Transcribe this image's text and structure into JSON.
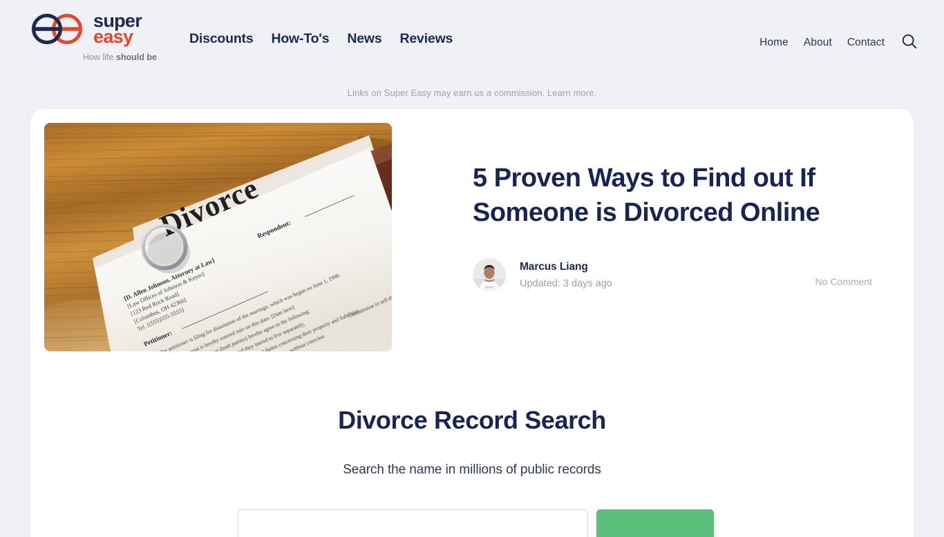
{
  "brand": {
    "name_part1": "super",
    "name_part2": "easy",
    "tagline_prefix": "How life ",
    "tagline_strong": "should be",
    "logo_navy": "#1b2a4e",
    "logo_red": "#e8452c"
  },
  "nav": {
    "primary": [
      {
        "label": "Discounts"
      },
      {
        "label": "How-To's"
      },
      {
        "label": "News"
      },
      {
        "label": "Reviews"
      }
    ],
    "utility": [
      {
        "label": "Home"
      },
      {
        "label": "About"
      },
      {
        "label": "Contact"
      }
    ],
    "search_icon": "search-icon"
  },
  "disclaimer": {
    "text": "Links on Super Easy may earn us a commission. ",
    "link_label": "Learn more."
  },
  "article": {
    "title": "5 Proven Ways to Find out If Someone is Divorced Online",
    "author": "Marcus Liang",
    "updated": "Updated: 3 days ago",
    "comments": "No Comment",
    "hero_alt": "divorce-papers-photo",
    "hero_doc": {
      "heading": "Divorce",
      "attorney": "[D. Allen Johnson, Attorney at Law]",
      "firm": "[Law Offices of Johnson & Keyes]",
      "street": "[123 Red Rock Road]",
      "city": "[Columbus, OH 42366]",
      "tel": "Tel. [(555)555-5555]",
      "petitioner": "Petitioner:",
      "respondent": "Respondent:",
      "body1": "The petitioner is filing for dissolution of the marriage, which was begun on June 1, 1998.",
      "body2": "This agreement is hereby entered into on this date: [Date here]",
      "body3": "and respondent (both parties) hereby agree to the following:",
      "body4": "s exist and they intend to live separately,",
      "body5": "tive rights and duties concerning their property and liabilities,",
      "body6": "eed to it by choice, without coercion",
      "body7": "Commission to sell the prop"
    }
  },
  "search_widget": {
    "title": "Divorce Record Search",
    "subtitle": "Search the name in millions of public records",
    "input_value": "",
    "input_placeholder": "",
    "button_label": "",
    "button_color": "#5cc07d"
  }
}
